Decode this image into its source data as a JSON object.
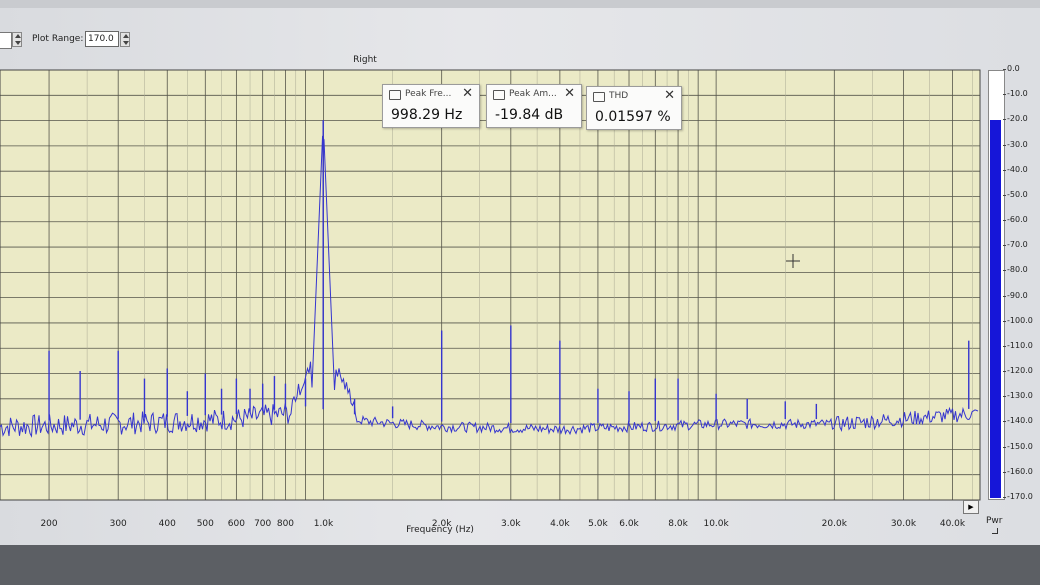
{
  "toolbar": {
    "plot_range_label": "Plot Range:",
    "plot_range_value": "170.0"
  },
  "channel_title": "Right",
  "popups": [
    {
      "label": "Peak Fre...",
      "value": "998.29 Hz"
    },
    {
      "label": "Peak Am...",
      "value": "-19.84 dB"
    },
    {
      "label": "THD",
      "value": "0.01597 %"
    }
  ],
  "meter": {
    "label": "Pwr",
    "level_db": -19.84,
    "ticks": [
      "0.0",
      "-10.0",
      "-20.0",
      "-30.0",
      "-40.0",
      "-50.0",
      "-60.0",
      "-70.0",
      "-80.0",
      "-90.0",
      "-100.0",
      "-110.0",
      "-120.0",
      "-130.0",
      "-140.0",
      "-150.0",
      "-160.0",
      "-170.0"
    ]
  },
  "colors": {
    "plot_bg": "#ebeac6",
    "trace": "#3535cf",
    "grid_major": "#55554a",
    "grid_minor": "#a9a994",
    "meter_fill": "#1616d8"
  },
  "chart_data": {
    "type": "line",
    "xlabel": "Frequency (Hz)",
    "x_scale": "log",
    "xlim": [
      150,
      47000
    ],
    "ylim": [
      -170,
      0
    ],
    "x_tick_labels": [
      {
        "v": 200,
        "t": "200"
      },
      {
        "v": 300,
        "t": "300"
      },
      {
        "v": 400,
        "t": "400"
      },
      {
        "v": 500,
        "t": "500"
      },
      {
        "v": 600,
        "t": "600"
      },
      {
        "v": 700,
        "t": "700"
      },
      {
        "v": 800,
        "t": "800"
      },
      {
        "v": 1000,
        "t": "1.0k"
      },
      {
        "v": 2000,
        "t": "2.0k"
      },
      {
        "v": 3000,
        "t": "3.0k"
      },
      {
        "v": 4000,
        "t": "4.0k"
      },
      {
        "v": 5000,
        "t": "5.0k"
      },
      {
        "v": 6000,
        "t": "6.0k"
      },
      {
        "v": 8000,
        "t": "8.0k"
      },
      {
        "v": 10000,
        "t": "10.0k"
      },
      {
        "v": 20000,
        "t": "20.0k"
      },
      {
        "v": 30000,
        "t": "30.0k"
      },
      {
        "v": 40000,
        "t": "40.0k"
      }
    ],
    "noise_floor": [
      [
        150,
        -141
      ],
      [
        280,
        -140
      ],
      [
        600,
        -138
      ],
      [
        900,
        -135
      ],
      [
        1300,
        -139
      ],
      [
        2000,
        -141
      ],
      [
        4000,
        -142
      ],
      [
        10000,
        -140
      ],
      [
        20000,
        -140
      ],
      [
        30000,
        -138
      ],
      [
        44000,
        -136
      ]
    ],
    "peaks": [
      [
        200,
        -111
      ],
      [
        240,
        -119
      ],
      [
        300,
        -111
      ],
      [
        350,
        -122
      ],
      [
        400,
        -118
      ],
      [
        450,
        -127
      ],
      [
        500,
        -120
      ],
      [
        550,
        -126
      ],
      [
        600,
        -122
      ],
      [
        650,
        -126
      ],
      [
        700,
        -124
      ],
      [
        750,
        -121
      ],
      [
        800,
        -124
      ],
      [
        900,
        -122
      ],
      [
        998.29,
        -19.84
      ],
      [
        1200,
        -130
      ],
      [
        1500,
        -133
      ],
      [
        2000,
        -103
      ],
      [
        3000,
        -101
      ],
      [
        4000,
        -107
      ],
      [
        5000,
        -126
      ],
      [
        6000,
        -127
      ],
      [
        7000,
        -122
      ],
      [
        8000,
        -122
      ],
      [
        10000,
        -128
      ],
      [
        12000,
        -130
      ],
      [
        15000,
        -131
      ],
      [
        18000,
        -132
      ],
      [
        44000,
        -107
      ]
    ]
  }
}
